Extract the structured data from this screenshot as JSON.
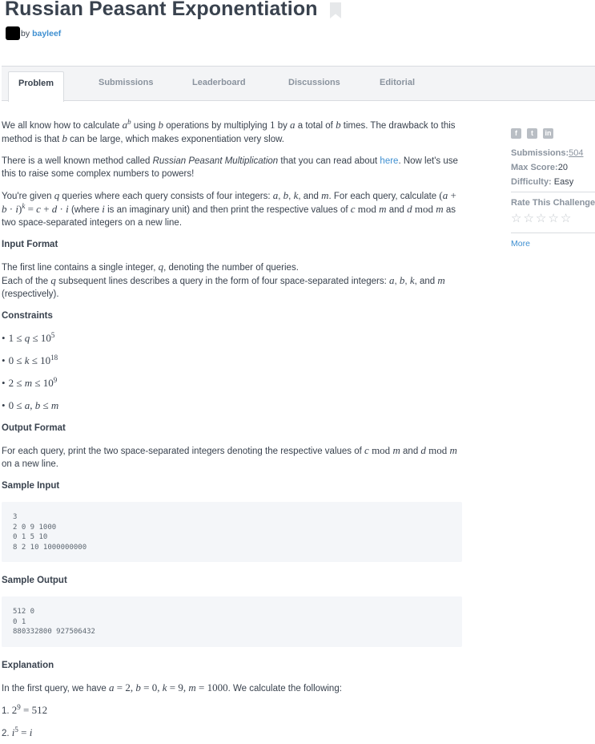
{
  "title": "Russian Peasant Exponentiation",
  "author": {
    "by_label": "by",
    "name": "bayleef"
  },
  "tabs": [
    "Problem",
    "Submissions",
    "Leaderboard",
    "Discussions",
    "Editorial"
  ],
  "sidebar": {
    "submissions_label": "Submissions:",
    "submissions_value": "504",
    "max_score_label": "Max Score:",
    "max_score_value": "20",
    "difficulty_label": "Difficulty:",
    "difficulty_value": "Easy",
    "rate_label": "Rate This Challenge:",
    "more_label": "More",
    "share_icons": [
      "facebook-icon",
      "twitter-icon",
      "linkedin-icon"
    ]
  },
  "problem": {
    "p1a": "We all know how to calculate ",
    "p1b": " using ",
    "p1c": " operations by multiplying ",
    "p1d": " by ",
    "p1e": " a total of ",
    "p1f": " times. The drawback to this method is that ",
    "p1g": " can be large, which makes exponentiation very slow.",
    "p2a": "There is a well known method called ",
    "p2em": "Russian Peasant Multiplication",
    "p2b": " that you can read about ",
    "p2link": "here",
    "p2c": ". Now let's use this to raise some complex numbers to powers!",
    "p3a": "You're given ",
    "p3b": " queries where each query consists of four integers: ",
    "p3c": ". For each query, calculate ",
    "p3d": " (where ",
    "p3e": " is an imaginary unit) and then print the respective values of ",
    "p3f": " and ",
    "p3g": " as two space-separated integers on a new line.",
    "input_heading": "Input Format",
    "in1a": "The first line contains a single integer, ",
    "in1b": ", denoting the number of queries.",
    "in2a": "Each of the ",
    "in2b": " subsequent lines describes a query in the form of four space-separated integers: ",
    "in2c": " (respectively).",
    "constraints_heading": "Constraints",
    "output_heading": "Output Format",
    "outa": "For each query, print the two space-separated integers denoting the respective values of ",
    "outb": " and ",
    "outc": " on a new line.",
    "sample_input_heading": "Sample Input",
    "sample_input": "3\n2 0 9 1000\n0 1 5 10\n8 2 10 1000000000",
    "sample_output_heading": "Sample Output",
    "sample_output": "512 0\n0 1\n880332800 927506432",
    "explanation_heading": "Explanation",
    "expa": "In the first query, we have ",
    "expb": ". We calculate the following:",
    "step1_num": "1. ",
    "step2_num": "2. "
  }
}
